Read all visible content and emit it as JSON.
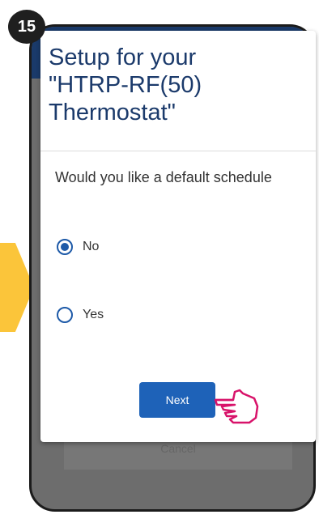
{
  "step": {
    "number": "15"
  },
  "dialog": {
    "title_line1": "Setup for your",
    "title_line2": "\"HTRP-RF(50)",
    "title_line3": "Thermostat\"",
    "question": "Would you like a default schedule",
    "options": [
      {
        "label": "No",
        "selected": true
      },
      {
        "label": "Yes",
        "selected": false
      }
    ],
    "next_label": "Next"
  },
  "background": {
    "cancel_label": "Cancel"
  },
  "colors": {
    "header": "#1a3a6a",
    "title_text": "#1b3a6b",
    "accent": "#1e62b8",
    "pointer_arrow": "#fbc53a",
    "hand_outline": "#d8136a"
  }
}
